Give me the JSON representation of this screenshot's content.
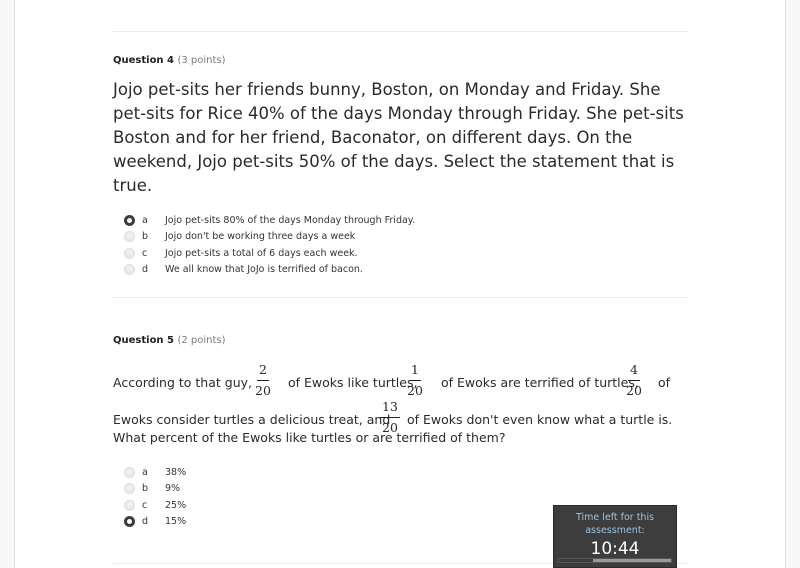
{
  "question4": {
    "title": "Question 4",
    "points": "(3 points)",
    "text": "Jojo pet-sits her friends bunny, Boston, on Monday and Friday. She pet-sits for Rice 40% of the days Monday through Friday. She pet-sits Boston and for her friend, Baconator, on different days. On the weekend, Jojo pet-sits 50% of the days. Select the statement that is true.",
    "selected": "a",
    "options": [
      {
        "letter": "a",
        "text": "Jojo pet-sits 80% of the days Monday through Friday."
      },
      {
        "letter": "b",
        "text": "Jojo don't be working three days a week"
      },
      {
        "letter": "c",
        "text": "Jojo pet-sits a total of 6 days each week."
      },
      {
        "letter": "d",
        "text": "We all know that JoJo is terrified of bacon."
      }
    ]
  },
  "question5": {
    "title": "Question 5",
    "points": "(2 points)",
    "text_parts": {
      "p1": "According to that guy,",
      "f1_num": "2",
      "f1_den": "20",
      "p2": "of Ewoks like turtles,",
      "f2_num": "1",
      "f2_den": "20",
      "p3": "of Ewoks are terrified of turtles,",
      "f3_num": "4",
      "f3_den": "20",
      "p4": "of",
      "p5": "Ewoks consider turtles a delicious treat, and",
      "f4_num": "13",
      "f4_den": "20",
      "p6": "of Ewoks don't even know what a turtle is.",
      "p7": "What percent of the Ewoks like turtles or are terrified of them?"
    },
    "selected": "d",
    "options": [
      {
        "letter": "a",
        "text": "38%"
      },
      {
        "letter": "b",
        "text": "9%"
      },
      {
        "letter": "c",
        "text": "25%"
      },
      {
        "letter": "d",
        "text": "15%"
      }
    ]
  },
  "timer": {
    "label": "Time left for this assessment:",
    "value": "10:44",
    "elapsed_fraction": 0.3
  },
  "colors": {
    "timer_label": "#9cc4de",
    "timer_bg": "#3d3d3d"
  }
}
